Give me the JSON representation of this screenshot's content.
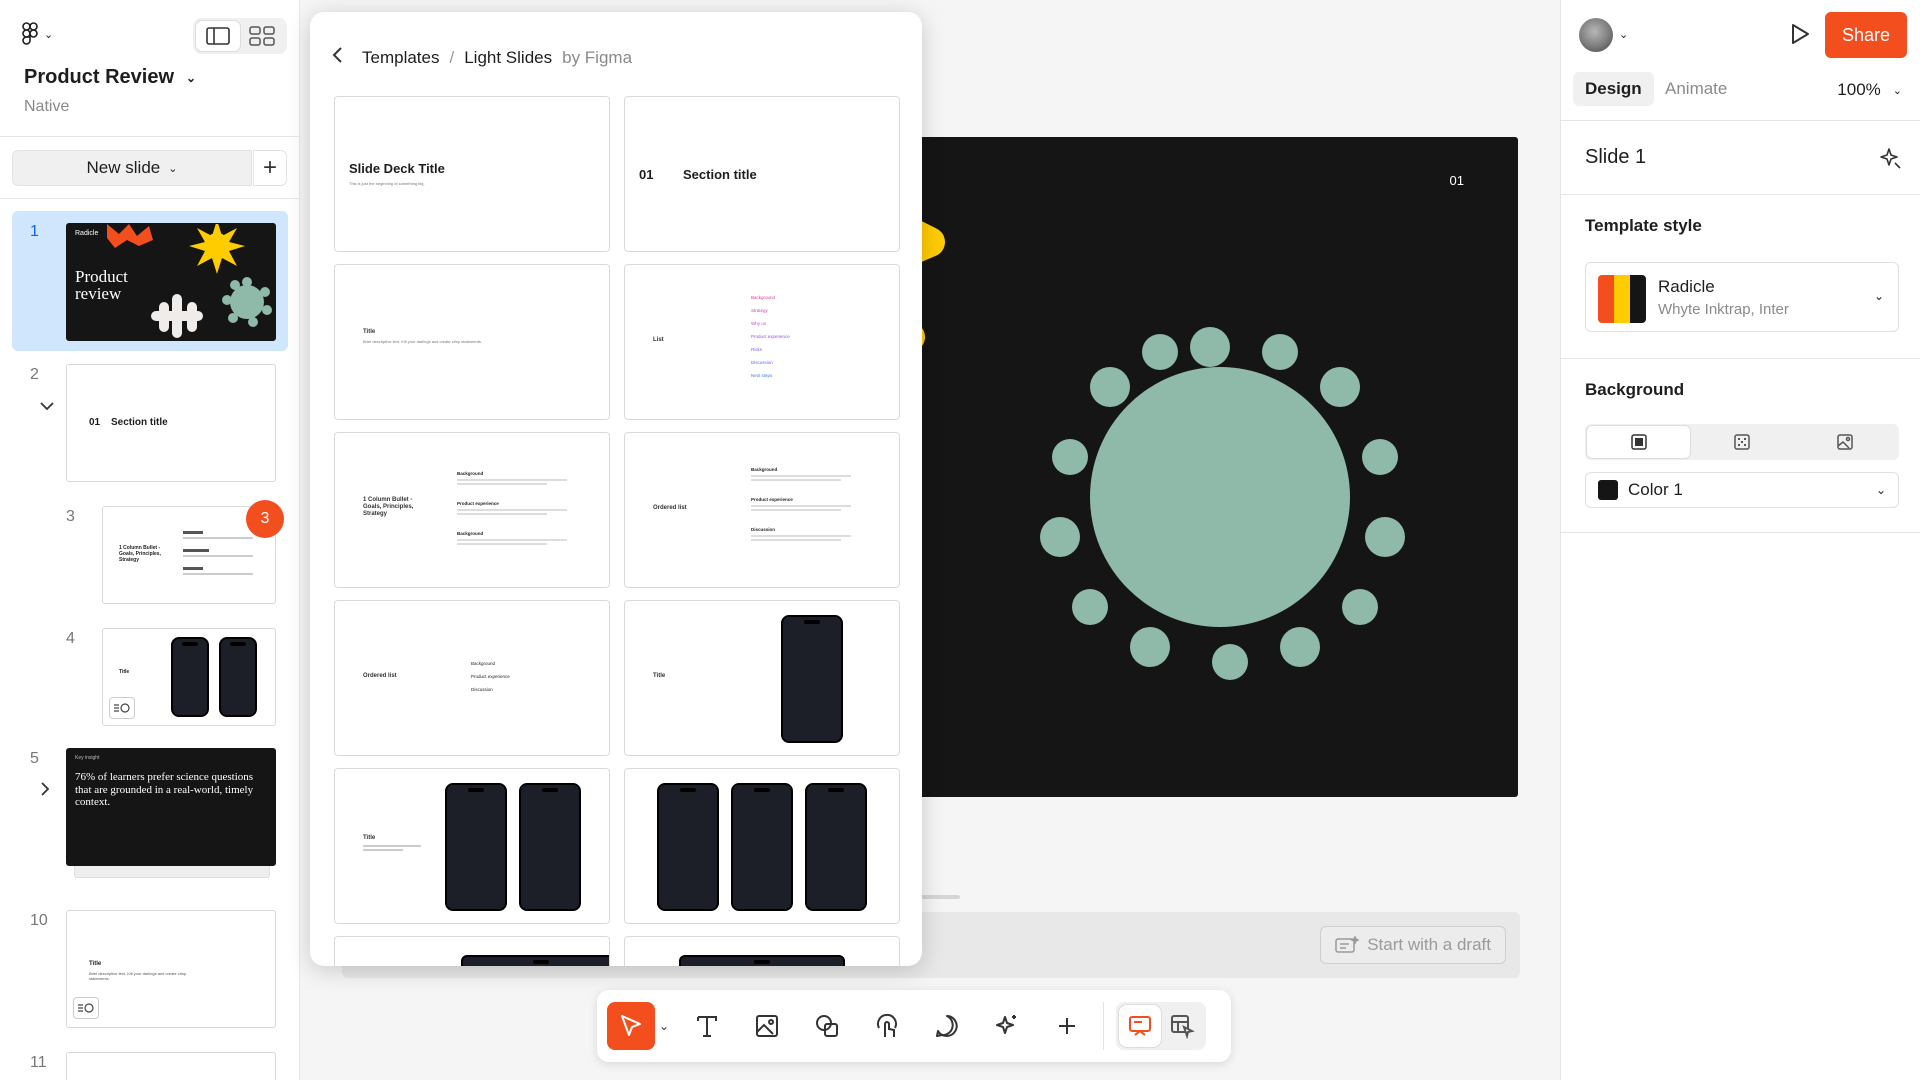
{
  "file": {
    "title": "Product Review",
    "subtitle": "Native"
  },
  "left": {
    "new_slide_label": "New slide",
    "add_label": "+",
    "slides": [
      {
        "num": "1",
        "brand": "Radicle",
        "title": "Product review"
      },
      {
        "num": "2",
        "section_num": "01",
        "section_label": "Section title"
      },
      {
        "num": "3",
        "title": "1 Column Bullet - Goals, Principles, Strategy",
        "badge": "3"
      },
      {
        "num": "4",
        "title": "Title"
      },
      {
        "num": "5",
        "label": "Key insight",
        "quote": "76% of learners prefer science questions that are grounded in a real-world, timely context."
      },
      {
        "num": "10",
        "title": "Title",
        "body": "Brief descriptive text. Kill your darlings and create crisp statements."
      },
      {
        "num": "11"
      }
    ]
  },
  "templates": {
    "back_label": "Templates",
    "separator": "/",
    "collection": "Light Slides",
    "by": "by Figma",
    "cards": {
      "deck_title": "Slide Deck Title",
      "deck_sub": "This is just the beginning of something big.",
      "section_num": "01",
      "section_title": "Section title",
      "title": "Title",
      "title_body": "Brief descriptive text. Kill your darlings and create crisp statements.",
      "list_title": "List",
      "list_items": [
        "Background",
        "Strategy",
        "Why us",
        "Product experience",
        "Risks",
        "Discussion",
        "Next steps"
      ],
      "bullet_title": "1 Column Bullet - Goals, Principles, Strategy",
      "bullet_items": [
        "Background",
        "Product experience",
        "Background"
      ],
      "ordered_title": "Ordered list",
      "ordered_items": [
        "Background",
        "Product experience",
        "Discussion"
      ],
      "ordered2_title": "Ordered list",
      "ordered2_items": [
        "Background",
        "Product experience",
        "Discussion"
      ],
      "phone_title": "Title",
      "two_phone_title": "Title"
    }
  },
  "canvas": {
    "slide_number": "01",
    "draft_button": "Start with a draft",
    "colors": {
      "sun": "#ffcc00",
      "cross": "#f0ece9",
      "blob": "#8fb9a8",
      "bg": "#151515"
    }
  },
  "toolbar": {
    "tools": [
      "move-tool",
      "text-tool",
      "image-tool",
      "shape-tool",
      "interactive-tool",
      "comment-tool",
      "ai-tool",
      "add-tool"
    ],
    "modes": [
      "slide-view",
      "design-view"
    ]
  },
  "right": {
    "share_label": "Share",
    "tabs": [
      "Design",
      "Animate"
    ],
    "zoom": "100%",
    "slide_name": "Slide 1",
    "template_style_heading": "Template style",
    "style_name": "Radicle",
    "style_fonts": "Whyte Inktrap, Inter",
    "swatch_colors": [
      "#f24e1e",
      "#ffcc00",
      "#151515"
    ],
    "background_heading": "Background",
    "color_label": "Color 1",
    "color_value": "#151515"
  }
}
